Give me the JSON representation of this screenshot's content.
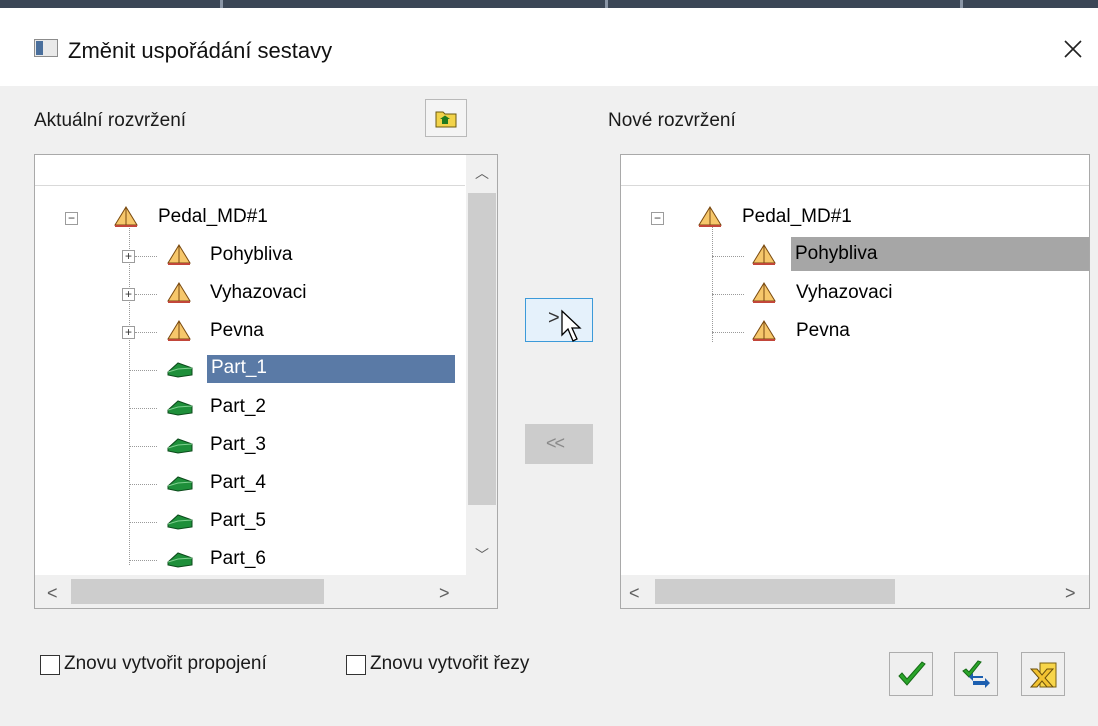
{
  "window": {
    "title": "Změnit uspořádání sestavy"
  },
  "left": {
    "label": "Aktuální rozvržení",
    "root": "Pedal_MD#1",
    "assemblies": [
      "Pohybliva",
      "Vyhazovaci",
      "Pevna"
    ],
    "parts": [
      "Part_1",
      "Part_2",
      "Part_3",
      "Part_4",
      "Part_5",
      "Part_6"
    ],
    "selected": "Part_1"
  },
  "right": {
    "label": "Nové rozvržení",
    "root": "Pedal_MD#1",
    "assemblies": [
      "Pohybliva",
      "Vyhazovaci",
      "Pevna"
    ],
    "selected": "Pohybliva"
  },
  "move_buttons": {
    "forward": ">",
    "back": "<<"
  },
  "options": {
    "recreate_connections": "Znovu vytvořit propojení",
    "recreate_sections": "Znovu vytvořit řezy"
  },
  "icons": {
    "assembly": "pyramid-assembly-icon",
    "part": "green-part-icon",
    "ok": "green-check-icon",
    "apply": "check-arrows-icon",
    "cancel": "yellow-cancel-icon",
    "up_level": "folder-up-icon"
  },
  "colors": {
    "selection_blue": "#5a7aa6",
    "selection_gray": "#a6a6a6",
    "check_green": "#2aa52a",
    "move_highlight": "#e5f1fb"
  }
}
